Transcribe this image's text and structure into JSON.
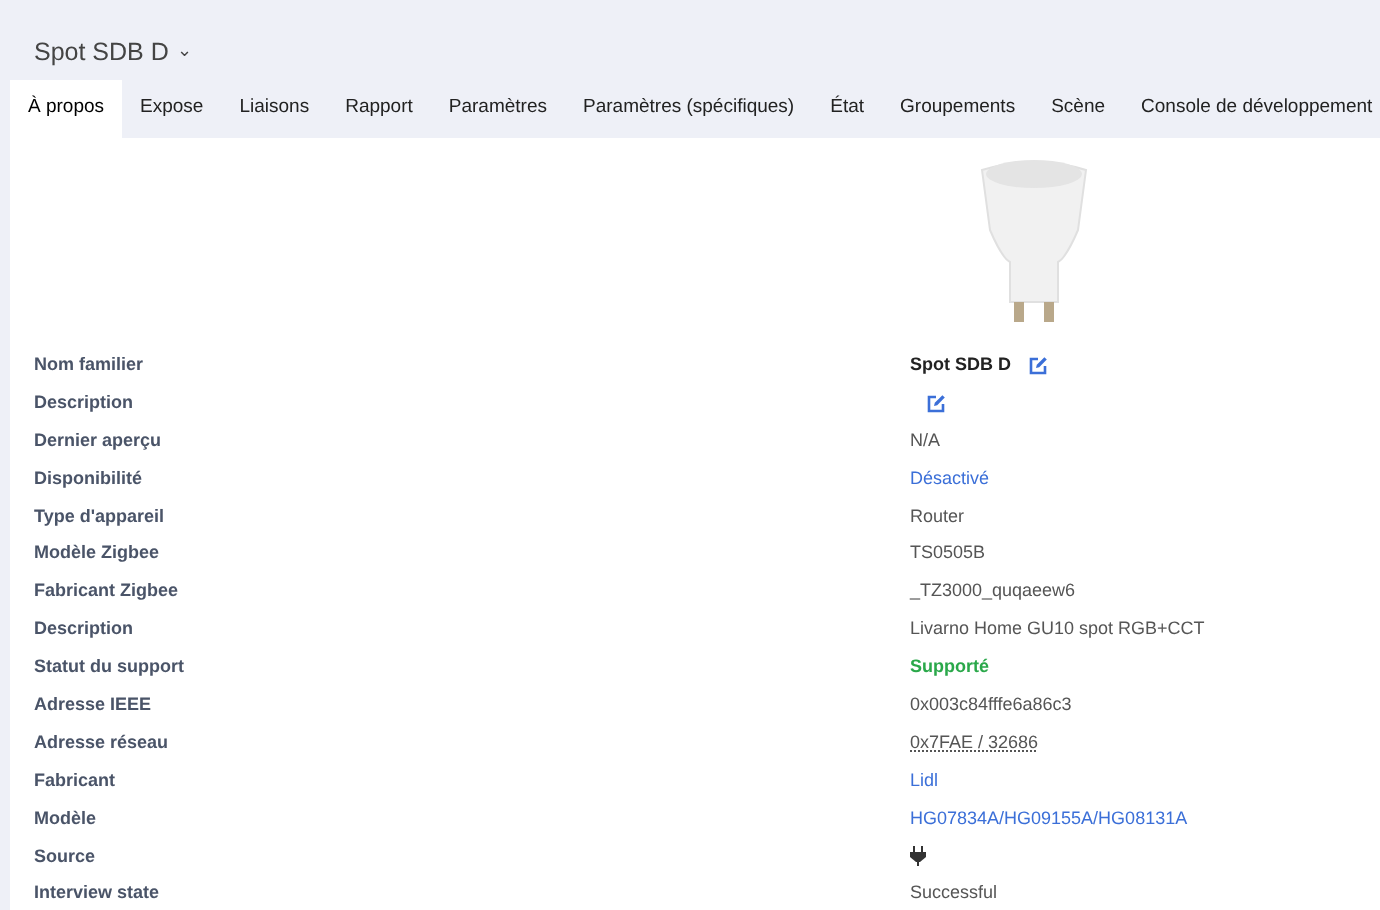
{
  "header": {
    "title": "Spot SDB D",
    "caret": "⌄"
  },
  "tabs": [
    {
      "label": "À propos",
      "selected": true
    },
    {
      "label": "Expose",
      "selected": false
    },
    {
      "label": "Liaisons",
      "selected": false
    },
    {
      "label": "Rapport",
      "selected": false
    },
    {
      "label": "Paramètres",
      "selected": false
    },
    {
      "label": "Paramètres (spécifiques)",
      "selected": false
    },
    {
      "label": "État",
      "selected": false
    },
    {
      "label": "Groupements",
      "selected": false
    },
    {
      "label": "Scène",
      "selected": false
    },
    {
      "label": "Console de développement",
      "selected": false
    }
  ],
  "rows": [
    {
      "label": "Nom familier",
      "kind": "editable",
      "value": "Spot SDB D"
    },
    {
      "label": "Description",
      "kind": "edit-only"
    },
    {
      "label": "Dernier aperçu",
      "kind": "text",
      "value": "N/A"
    },
    {
      "label": "Disponibilité",
      "kind": "link",
      "value": "Désactivé"
    },
    {
      "label": "Type d'appareil",
      "kind": "text",
      "value": "Router"
    },
    {
      "label": "Modèle Zigbee",
      "kind": "text",
      "value": "TS0505B"
    },
    {
      "label": "Fabricant Zigbee",
      "kind": "text",
      "value": "_TZ3000_quqaeew6"
    },
    {
      "label": "Description",
      "kind": "text",
      "value": "Livarno Home GU10 spot RGB+CCT"
    },
    {
      "label": "Statut du support",
      "kind": "success",
      "value": "Supporté"
    },
    {
      "label": "Adresse IEEE",
      "kind": "text",
      "value": "0x003c84fffe6a86c3"
    },
    {
      "label": "Adresse réseau",
      "kind": "dotted",
      "value": "0x7FAE / 32686"
    },
    {
      "label": "Fabricant",
      "kind": "link",
      "value": "Lidl"
    },
    {
      "label": "Modèle",
      "kind": "link",
      "value": "HG07834A/HG09155A/HG08131A"
    },
    {
      "label": "Source",
      "kind": "plug"
    },
    {
      "label": "Interview state",
      "kind": "text",
      "value": "Successful"
    }
  ]
}
